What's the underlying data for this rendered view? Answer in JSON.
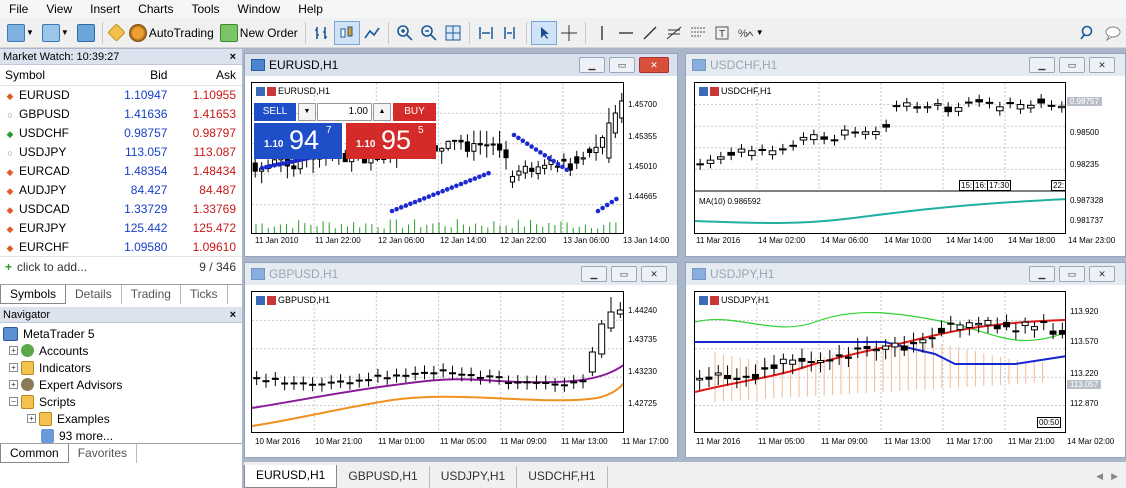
{
  "menu": [
    "File",
    "View",
    "Insert",
    "Charts",
    "Tools",
    "Window",
    "Help"
  ],
  "toolbar": {
    "autotrading": "AutoTrading",
    "new_order": "New Order"
  },
  "market_watch": {
    "title": "Market Watch: 10:39:27",
    "close": "×",
    "headers": {
      "symbol": "Symbol",
      "bid": "Bid",
      "ask": "Ask"
    },
    "rows": [
      {
        "symbol": "EURUSD",
        "bid": "1.10947",
        "ask": "1.10955",
        "dir": "down"
      },
      {
        "symbol": "GBPUSD",
        "bid": "1.41636",
        "ask": "1.41653",
        "dir": "none"
      },
      {
        "symbol": "USDCHF",
        "bid": "0.98757",
        "ask": "0.98797",
        "dir": "up"
      },
      {
        "symbol": "USDJPY",
        "bid": "113.057",
        "ask": "113.087",
        "dir": "none"
      },
      {
        "symbol": "EURCAD",
        "bid": "1.48354",
        "ask": "1.48434",
        "dir": "down"
      },
      {
        "symbol": "AUDJPY",
        "bid": "84.427",
        "ask": "84.487",
        "dir": "down"
      },
      {
        "symbol": "USDCAD",
        "bid": "1.33729",
        "ask": "1.33769",
        "dir": "down"
      },
      {
        "symbol": "EURJPY",
        "bid": "125.442",
        "ask": "125.472",
        "dir": "down"
      },
      {
        "symbol": "EURCHF",
        "bid": "1.09580",
        "ask": "1.09610",
        "dir": "down"
      }
    ],
    "add": "click to add...",
    "count": "9 / 346",
    "tabs": [
      "Symbols",
      "Details",
      "Trading",
      "Ticks"
    ]
  },
  "navigator": {
    "title": "Navigator",
    "close": "×",
    "items": [
      "MetaTrader 5",
      "Accounts",
      "Indicators",
      "Expert Advisors",
      "Scripts",
      "Examples",
      "93 more..."
    ],
    "tabs": [
      "Common",
      "Favorites"
    ]
  },
  "charts": {
    "eurusd": {
      "title": "EURUSD,H1",
      "label": "EURUSD,H1",
      "trade": {
        "sell": "SELL",
        "buy": "BUY",
        "volume": "1.00",
        "sell_small": "1.10",
        "sell_big": "94",
        "sell_sup": "7",
        "buy_small": "1.10",
        "buy_big": "95",
        "buy_sup": "5"
      },
      "yticks": [
        "1.45700",
        "1.45355",
        "1.45010",
        "1.44665"
      ],
      "xticks": [
        "11 Jan 2010",
        "11 Jan 22:00",
        "12 Jan 06:00",
        "12 Jan 14:00",
        "12 Jan 22:00",
        "13 Jan 06:00",
        "13 Jan 14:00"
      ]
    },
    "usdchf": {
      "title": "USDCHF,H1",
      "label": "USDCHF,H1",
      "price_tag": "0.98757",
      "yticks": [
        "0.98500",
        "0.98235"
      ],
      "ind_yticks": [
        "0.987328",
        "0.981737"
      ],
      "indicator": "MA(10) 0.986592",
      "time_marks": [
        "15:",
        "16:",
        "17:30",
        "22:"
      ],
      "xticks": [
        "11 Mar 2016",
        "14 Mar 02:00",
        "14 Mar 06:00",
        "14 Mar 10:00",
        "14 Mar 14:00",
        "14 Mar 18:00",
        "14 Mar 23:00"
      ]
    },
    "gbpusd": {
      "title": "GBPUSD,H1",
      "label": "GBPUSD,H1",
      "yticks": [
        "1.44240",
        "1.43735",
        "1.43230",
        "1.42725"
      ],
      "xticks": [
        "10 Mar 2016",
        "10 Mar 21:00",
        "11 Mar 01:00",
        "11 Mar 05:00",
        "11 Mar 09:00",
        "11 Mar 13:00",
        "11 Mar 17:00"
      ]
    },
    "usdjpy": {
      "title": "USDJPY,H1",
      "label": "USDJPY,H1",
      "price_tag": "113.057",
      "yticks": [
        "113.920",
        "113.570",
        "113.220",
        "112.870"
      ],
      "time_box": "00:50",
      "xticks": [
        "11 Mar 2016",
        "11 Mar 05:00",
        "11 Mar 09:00",
        "11 Mar 13:00",
        "11 Mar 17:00",
        "11 Mar 21:00",
        "14 Mar 02:00"
      ]
    }
  },
  "bottom_tabs": [
    "EURUSD,H1",
    "GBPUSD,H1",
    "USDJPY,H1",
    "USDCHF,H1"
  ],
  "colors": {
    "bid": "#1840c8",
    "ask": "#c81818",
    "sell": "#1f4fc8",
    "buy": "#d42a2a",
    "up_arrow": "#2a9a2a",
    "down_arrow": "#e05a2a"
  }
}
